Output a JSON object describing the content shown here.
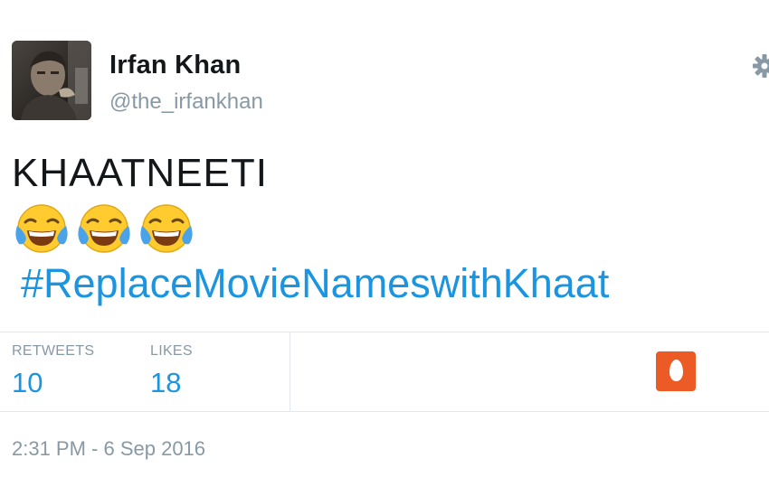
{
  "author": {
    "name": "Irfan Khan",
    "handle": "@the_irfankhan"
  },
  "header": {
    "menu_icon": "gear-icon"
  },
  "tweet": {
    "text": "KHAATNEETI",
    "emojis": [
      "face-with-tears-of-joy",
      "face-with-tears-of-joy",
      "face-with-tears-of-joy"
    ],
    "hashtag": "#ReplaceMovieNameswithKhaat"
  },
  "stats": {
    "retweets_label": "RETWEETS",
    "retweets_value": "10",
    "likes_label": "LIKES",
    "likes_value": "18",
    "badge_icon": "egg-icon"
  },
  "timestamp": "2:31 PM - 6 Sep 2016",
  "colors": {
    "link": "#1b95e0",
    "muted": "#8899a6",
    "text": "#14171a",
    "badge": "#ec5a26",
    "divider": "#e1e8ed"
  }
}
